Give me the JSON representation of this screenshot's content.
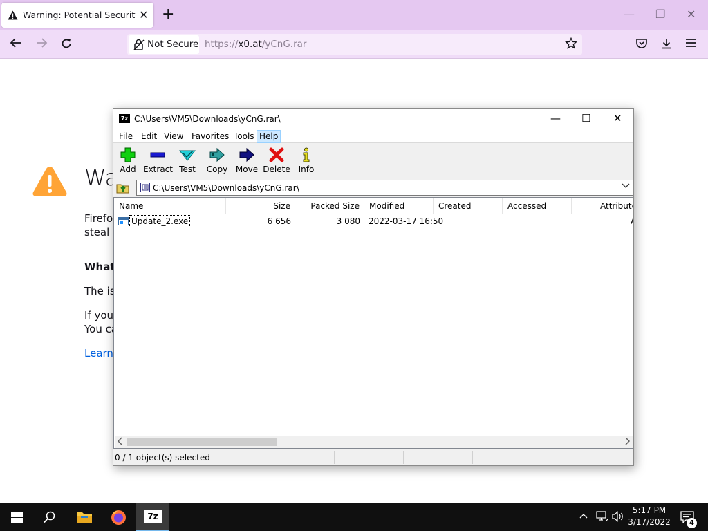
{
  "browser": {
    "tab_title": "Warning: Potential Security Risk Ahead",
    "new_tab_label": "+",
    "identity_label": "Not Secure",
    "url_scheme": "https://",
    "url_host": "x0.at",
    "url_path": "/yCnG.rar"
  },
  "warning_page": {
    "heading": "Wa",
    "line1": "Firefox",
    "line2": "steal i",
    "what_heading": "What",
    "issue_line": "The iss",
    "ifyou_line": "If you",
    "youcan_line": "You ca",
    "learn_link": "Learn"
  },
  "zip": {
    "title": "C:\\Users\\VM5\\Downloads\\yCnG.rar\\",
    "app_icon_text": "7z",
    "menu": [
      "File",
      "Edit",
      "View",
      "Favorites",
      "Tools",
      "Help"
    ],
    "toolbar": [
      "Add",
      "Extract",
      "Test",
      "Copy",
      "Move",
      "Delete",
      "Info"
    ],
    "address": "C:\\Users\\VM5\\Downloads\\yCnG.rar\\",
    "columns": [
      "Name",
      "Size",
      "Packed Size",
      "Modified",
      "Created",
      "Accessed",
      "Attributes"
    ],
    "files": [
      {
        "name": "Update_2.exe",
        "size": "6 656",
        "packed": "3 080",
        "modified": "2022-03-17 16:50",
        "created": "",
        "accessed": "",
        "attributes": "A"
      }
    ],
    "status_selected": "0 / 1 object(s) selected"
  },
  "taskbar": {
    "time": "5:17 PM",
    "date": "3/17/2022",
    "notification_count": "4",
    "zip_app_label": "7z"
  },
  "colors": {
    "firefox_tabbar": "#e5c8f1",
    "firefox_navbar": "#f0dcf8",
    "warning_orange": "#ffa436",
    "link_blue": "#0060df"
  }
}
